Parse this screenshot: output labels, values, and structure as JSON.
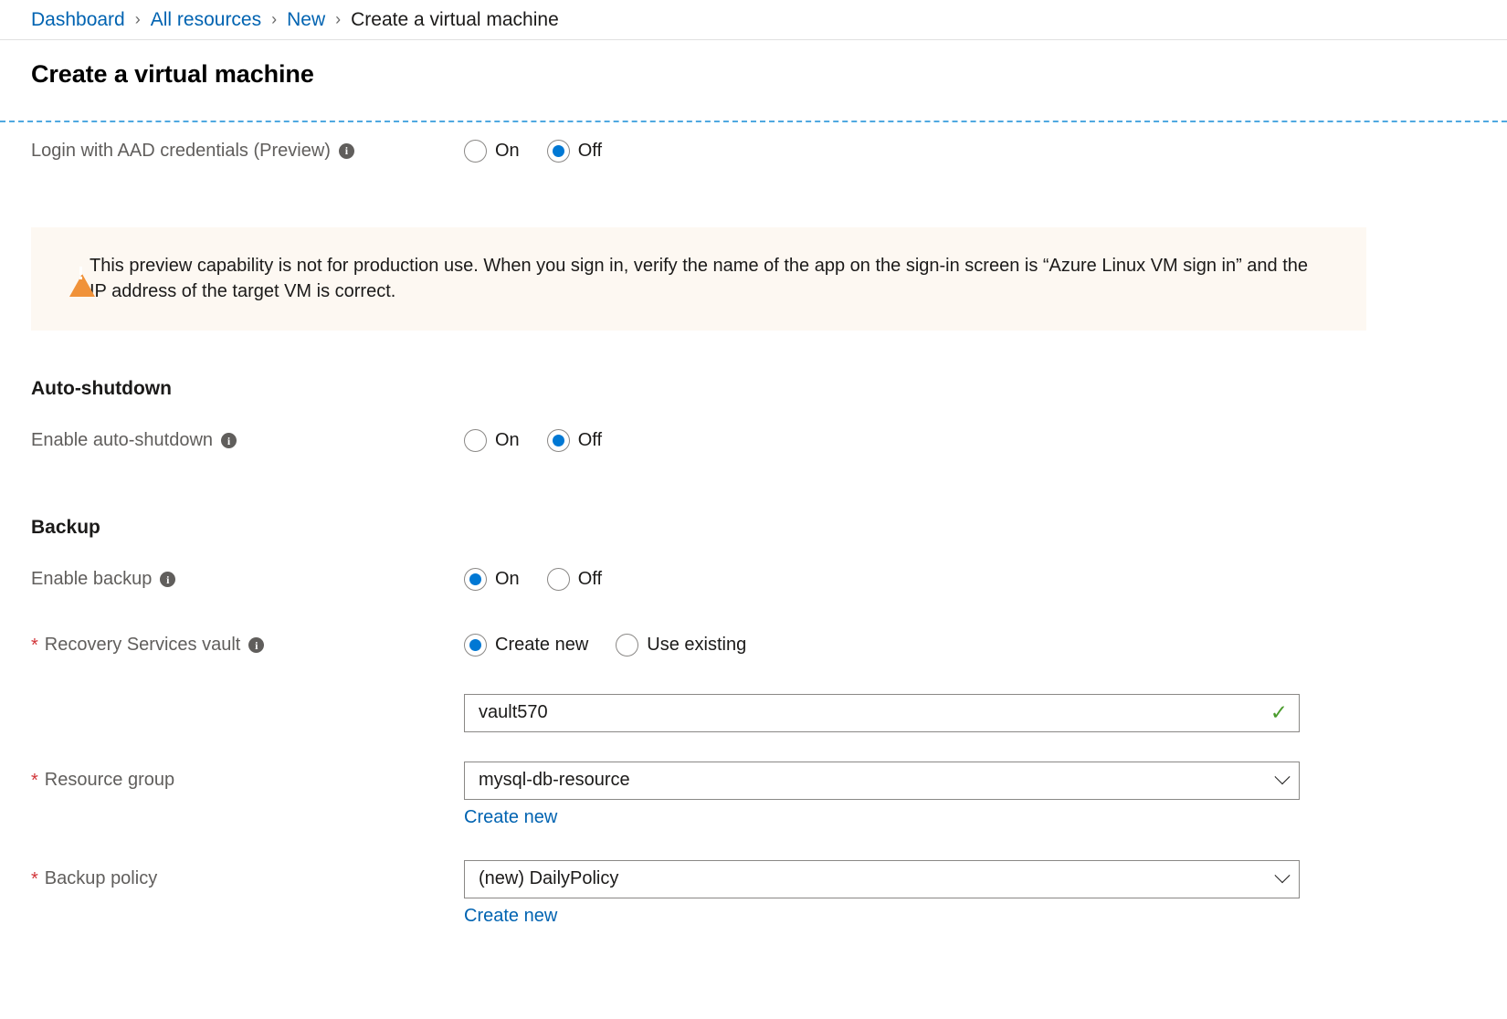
{
  "breadcrumb": {
    "items": [
      {
        "label": "Dashboard",
        "current": false
      },
      {
        "label": "All resources",
        "current": false
      },
      {
        "label": "New",
        "current": false
      },
      {
        "label": "Create a virtual machine",
        "current": true
      }
    ],
    "separator": "›"
  },
  "page": {
    "title": "Create a virtual machine"
  },
  "aad": {
    "label": "Login with AAD credentials (Preview)",
    "info_icon": "info-icon",
    "options": [
      {
        "label": "On",
        "selected": false
      },
      {
        "label": "Off",
        "selected": true
      }
    ]
  },
  "warning": {
    "icon": "warning-triangle-icon",
    "text": "This preview capability is not for production use.  When you sign in, verify the name of the app on the sign-in screen is “Azure Linux VM sign in” and the IP address of the target VM is correct."
  },
  "auto_shutdown": {
    "section_title": "Auto-shutdown",
    "label": "Enable auto-shutdown",
    "info_icon": "info-icon",
    "options": [
      {
        "label": "On",
        "selected": false
      },
      {
        "label": "Off",
        "selected": true
      }
    ]
  },
  "backup": {
    "section_title": "Backup",
    "enable": {
      "label": "Enable backup",
      "info_icon": "info-icon",
      "options": [
        {
          "label": "On",
          "selected": true
        },
        {
          "label": "Off",
          "selected": false
        }
      ]
    },
    "vault": {
      "required": "*",
      "label": "Recovery Services vault",
      "info_icon": "info-icon",
      "options": [
        {
          "label": "Create new",
          "selected": true
        },
        {
          "label": "Use existing",
          "selected": false
        }
      ],
      "name_value": "vault570",
      "name_placeholder": "",
      "validation_icon": "✓"
    },
    "resource_group": {
      "required": "*",
      "label": "Resource group",
      "value": "mysql-db-resource",
      "create_new_link": "Create new",
      "chevron": "chevron-down-icon"
    },
    "backup_policy": {
      "required": "*",
      "label": "Backup policy",
      "value": "(new) DailyPolicy",
      "create_new_link": "Create new",
      "chevron": "chevron-down-icon"
    }
  },
  "colors": {
    "accent": "#0078d4",
    "link": "#0063b1",
    "required": "#d13438",
    "warning_bg": "#fdf8f2",
    "warning_icon": "#f0923a",
    "success": "#4a9c2d",
    "dashed_rule": "#4fa8e0"
  }
}
